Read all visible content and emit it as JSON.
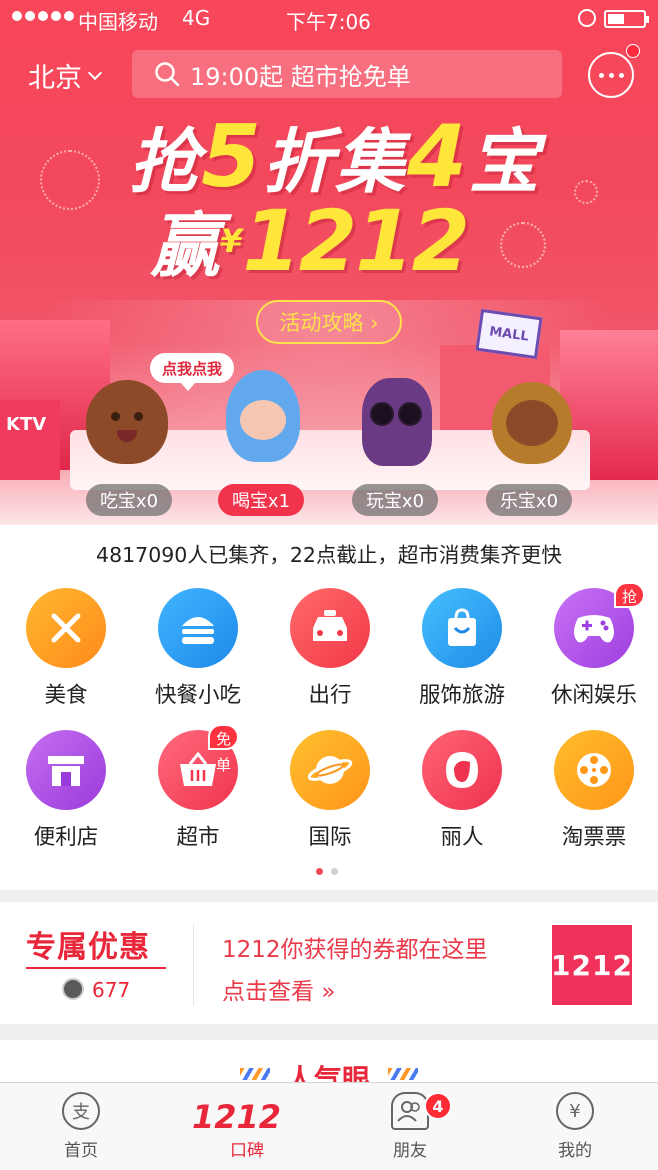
{
  "status_bar": {
    "carrier": "中国移动",
    "network": "4G",
    "time": "下午7:06"
  },
  "top_bar": {
    "city": "北京",
    "search_text": "19:00起 超市抢免单"
  },
  "hero": {
    "headline_prefix": "抢",
    "headline_num1": "5",
    "headline_mid": "折集",
    "headline_num2": "4",
    "headline_suffix": "宝",
    "headline2_prefix": "赢",
    "currency": "¥",
    "amount": "1212",
    "guide_button": "活动攻略 ›",
    "speech_bubble": "点我点我",
    "ktv_sign": "KTV",
    "mall_sign": "MALL",
    "counters": [
      {
        "label": "吃宝x0",
        "active": false
      },
      {
        "label": "喝宝x1",
        "active": true
      },
      {
        "label": "玩宝x0",
        "active": false
      },
      {
        "label": "乐宝x0",
        "active": false
      }
    ]
  },
  "collect_notice": "4817090人已集齐，22点截止，超市消费集齐更快",
  "categories": [
    {
      "label": "美食",
      "icon": "fork-knife-icon",
      "color": "#ff9a1a"
    },
    {
      "label": "快餐小吃",
      "icon": "burger-icon",
      "color": "#2a9bf2"
    },
    {
      "label": "出行",
      "icon": "taxi-icon",
      "color": "#f24a50"
    },
    {
      "label": "服饰旅游",
      "icon": "shopping-bag-icon",
      "color": "#2aa5f2"
    },
    {
      "label": "休闲娱乐",
      "icon": "gamepad-icon",
      "color": "#b455e8",
      "badge": "抢"
    },
    {
      "label": "便利店",
      "icon": "store-icon",
      "color": "#b053e2"
    },
    {
      "label": "超市",
      "icon": "basket-icon",
      "color": "#f24660",
      "badge": "免单"
    },
    {
      "label": "国际",
      "icon": "planet-icon",
      "color": "#ffa61c"
    },
    {
      "label": "丽人",
      "icon": "woman-icon",
      "color": "#f2405a"
    },
    {
      "label": "淘票票",
      "icon": "film-reel-icon",
      "color": "#ffa31a"
    }
  ],
  "promo": {
    "title": "专属优惠",
    "count": "677",
    "line1": "1212你获得的券都在这里",
    "line2": "点击查看",
    "tile": "1212"
  },
  "popular_title": "人气眼",
  "tabbar": {
    "home": "首页",
    "koubei": "口碑",
    "koubei_logo": "1212",
    "friends": "朋友",
    "friends_badge": "4",
    "mine": "我的"
  }
}
